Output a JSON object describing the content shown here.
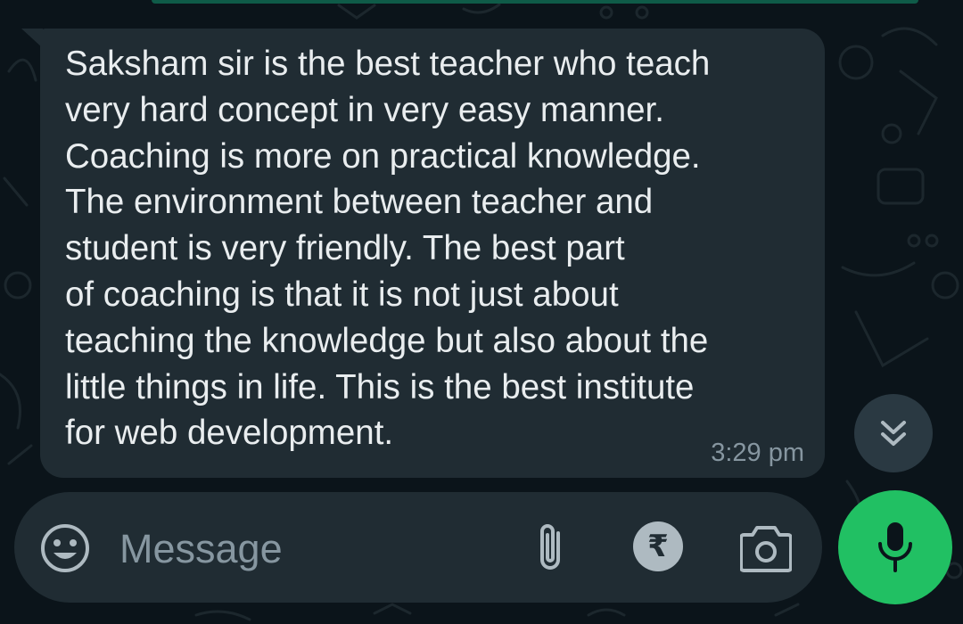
{
  "chat": {
    "messages": [
      {
        "lines": [
          "Saksham sir is the best teacher who teach",
          "very hard concept in very easy manner.",
          "Coaching is more on practical knowledge.",
          "The environment between teacher and",
          "student is very friendly. The best part",
          "of coaching is that it is not just about",
          "teaching the knowledge but also about the",
          "little things in life. This is the best institute",
          "for web development."
        ],
        "time": "3:29 pm"
      }
    ]
  },
  "composer": {
    "placeholder": "Message",
    "value": "",
    "rupee_symbol": "₹"
  },
  "icons": {
    "emoji": "emoji-smile-icon",
    "attach": "paperclip-icon",
    "payment": "rupee-icon",
    "camera": "camera-icon",
    "mic": "microphone-icon",
    "scroll": "double-chevron-down-icon"
  },
  "colors": {
    "background": "#0b141a",
    "bubble": "#202c33",
    "text": "#e9edef",
    "secondary_text": "#8696a0",
    "accent_green": "#21c063"
  }
}
